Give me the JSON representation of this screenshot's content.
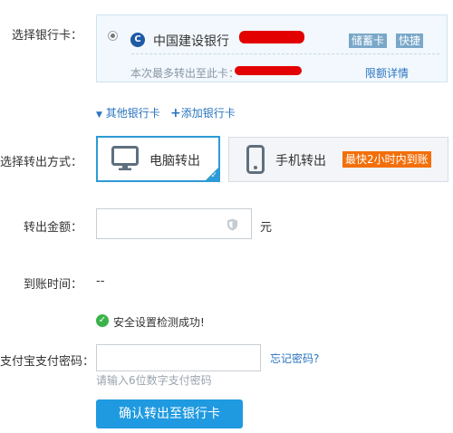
{
  "labels": {
    "select_card": "选择银行卡：",
    "select_method": "选择转出方式：",
    "amount": "转出金额：",
    "arrival_time": "到账时间：",
    "pay_password": "支付宝支付密码："
  },
  "card": {
    "bank_name": "中国建设银行",
    "tag_savings": "储蓄卡",
    "tag_quick": "快捷",
    "limit_text": "本次最多转出至此卡：",
    "limit_link": "限额详情"
  },
  "links": {
    "other_cards": "其他银行卡",
    "add_card": "添加银行卡"
  },
  "methods": {
    "pc_label": "电脑转出",
    "phone_label": "手机转出",
    "phone_badge": "最快2小时内到账"
  },
  "amount": {
    "value": "",
    "unit": "元"
  },
  "arrival": {
    "value": "--"
  },
  "security": {
    "message": "安全设置检测成功!"
  },
  "password": {
    "value": "",
    "forgot": "忘记密码?",
    "hint": "请输入6位数字支付密码"
  },
  "submit": {
    "label": "确认转出至银行卡"
  },
  "colors": {
    "accent": "#1f9ae0",
    "link": "#2a74c0",
    "badge": "#f36f0a",
    "success": "#3bb34a",
    "redaction": "#e30000"
  },
  "icons": {
    "bank": "ccb-logo-icon",
    "pc": "monitor-icon",
    "phone": "phone-icon",
    "shield": "shield-icon",
    "success": "check-circle-icon"
  }
}
